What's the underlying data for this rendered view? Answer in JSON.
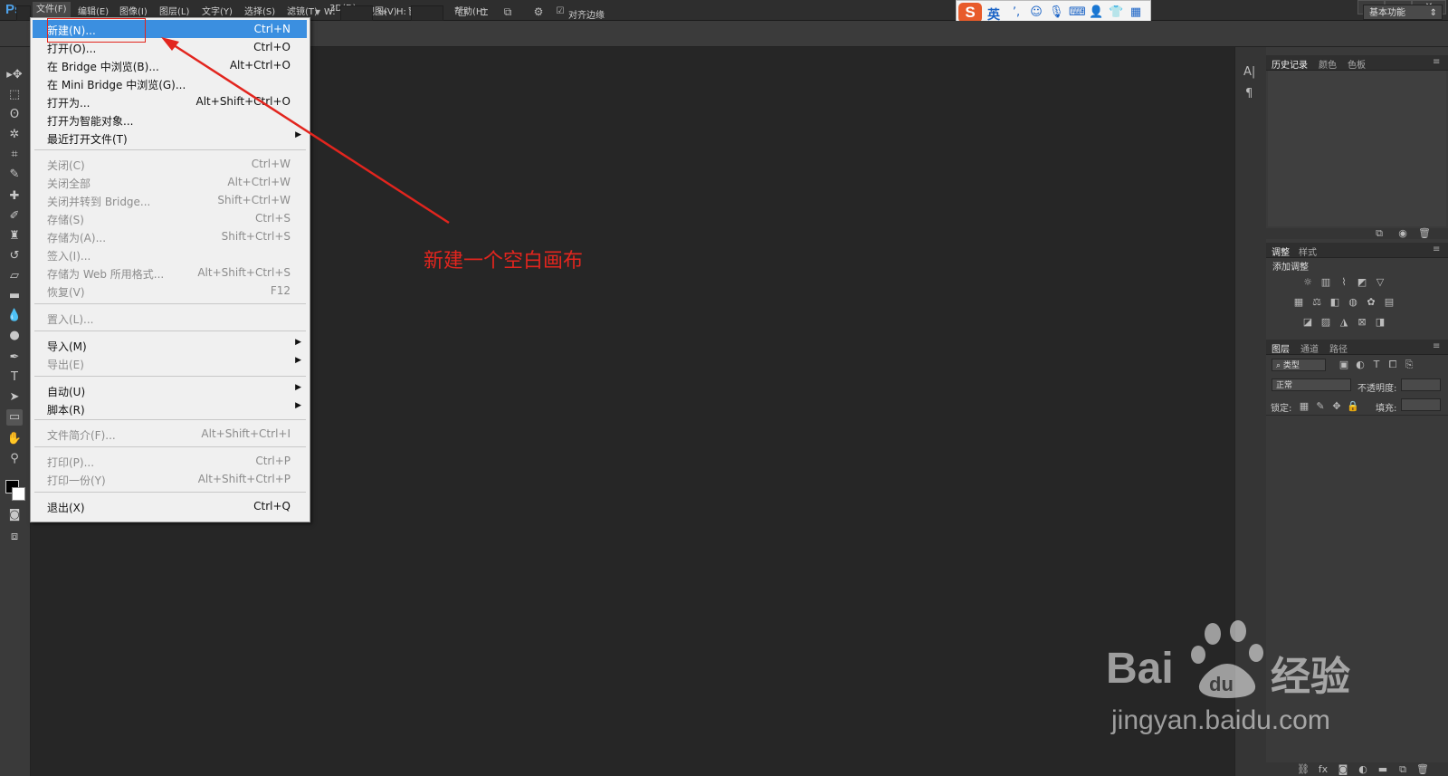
{
  "app": {
    "logo": "Ps",
    "workspace": "基本功能"
  },
  "menubar": {
    "items": [
      "文件(F)",
      "编辑(E)",
      "图像(I)",
      "图层(L)",
      "文字(Y)",
      "选择(S)",
      "滤镜(T)",
      "3D(D)",
      "视图(V)",
      "窗口(W)",
      "帮助(H)"
    ],
    "window_buttons": [
      "–",
      "▭",
      "✕"
    ]
  },
  "ime": {
    "logo": "S",
    "lang": "英",
    "icons": [
      "punct-icon",
      "emoji-icon",
      "mic-icon",
      "keyboard-icon",
      "user-icon",
      "skin-icon",
      "grid-icon"
    ]
  },
  "options": {
    "w_label": "W:",
    "h_label": "H:",
    "align_edges": "对齐边缘"
  },
  "file_menu": [
    {
      "label": "新建(N)...",
      "shortcut": "Ctrl+N",
      "state": "highlight"
    },
    {
      "label": "打开(O)...",
      "shortcut": "Ctrl+O",
      "state": "enabled"
    },
    {
      "label": "在 Bridge 中浏览(B)...",
      "shortcut": "Alt+Ctrl+O",
      "state": "enabled"
    },
    {
      "label": "在 Mini Bridge 中浏览(G)...",
      "shortcut": "",
      "state": "enabled"
    },
    {
      "label": "打开为...",
      "shortcut": "Alt+Shift+Ctrl+O",
      "state": "enabled"
    },
    {
      "label": "打开为智能对象...",
      "shortcut": "",
      "state": "enabled"
    },
    {
      "label": "最近打开文件(T)",
      "shortcut": "",
      "state": "enabled",
      "submenu": true
    },
    {
      "label": "关闭(C)",
      "shortcut": "Ctrl+W",
      "state": "disabled"
    },
    {
      "label": "关闭全部",
      "shortcut": "Alt+Ctrl+W",
      "state": "disabled"
    },
    {
      "label": "关闭并转到 Bridge...",
      "shortcut": "Shift+Ctrl+W",
      "state": "disabled"
    },
    {
      "label": "存储(S)",
      "shortcut": "Ctrl+S",
      "state": "disabled"
    },
    {
      "label": "存储为(A)...",
      "shortcut": "Shift+Ctrl+S",
      "state": "disabled"
    },
    {
      "label": "签入(I)...",
      "shortcut": "",
      "state": "disabled"
    },
    {
      "label": "存储为 Web 所用格式...",
      "shortcut": "Alt+Shift+Ctrl+S",
      "state": "disabled"
    },
    {
      "label": "恢复(V)",
      "shortcut": "F12",
      "state": "disabled"
    },
    {
      "label": "置入(L)...",
      "shortcut": "",
      "state": "disabled"
    },
    {
      "label": "导入(M)",
      "shortcut": "",
      "state": "enabled",
      "submenu": true
    },
    {
      "label": "导出(E)",
      "shortcut": "",
      "state": "disabled",
      "submenu": true
    },
    {
      "label": "自动(U)",
      "shortcut": "",
      "state": "enabled",
      "submenu": true
    },
    {
      "label": "脚本(R)",
      "shortcut": "",
      "state": "enabled",
      "submenu": true
    },
    {
      "label": "文件简介(F)...",
      "shortcut": "Alt+Shift+Ctrl+I",
      "state": "disabled"
    },
    {
      "label": "打印(P)...",
      "shortcut": "Ctrl+P",
      "state": "disabled"
    },
    {
      "label": "打印一份(Y)",
      "shortcut": "Alt+Shift+Ctrl+P",
      "state": "disabled"
    },
    {
      "label": "退出(X)",
      "shortcut": "Ctrl+Q",
      "state": "enabled"
    }
  ],
  "annotation": {
    "text": "新建一个空白画布",
    "color": "#e2251e"
  },
  "panels": {
    "history_tabs": [
      "历史记录",
      "颜色",
      "色板"
    ],
    "adjust_tabs": [
      "调整",
      "样式"
    ],
    "adjust_title": "添加调整",
    "layers_tabs": [
      "图层",
      "通道",
      "路径"
    ],
    "layers_filter": "类型",
    "blend_mode": "正常",
    "opacity_label": "不透明度:",
    "lock_label": "锁定:",
    "fill_label": "填充:"
  },
  "watermark": {
    "brand_left": "Bai",
    "brand_right": "经验",
    "paw_text": "du",
    "url": "jingyan.baidu.com"
  },
  "colors": {
    "menu_highlight": "#3b8fe0",
    "accent_red": "#e2251e",
    "ps_blue": "#4ea1e8"
  }
}
